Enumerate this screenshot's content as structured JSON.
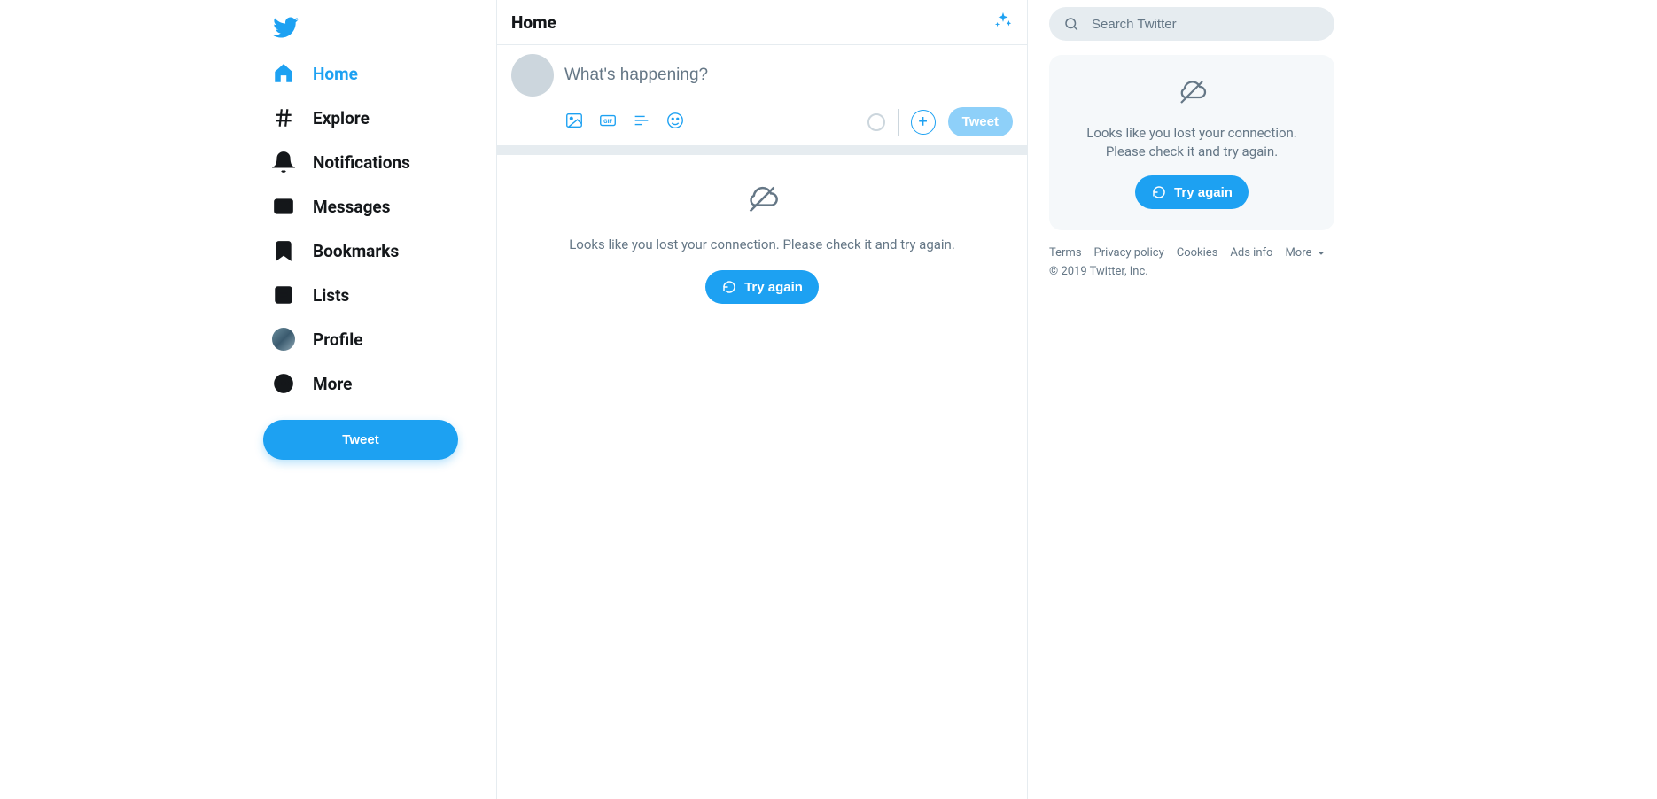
{
  "nav": {
    "items": [
      {
        "label": "Home"
      },
      {
        "label": "Explore"
      },
      {
        "label": "Notifications"
      },
      {
        "label": "Messages"
      },
      {
        "label": "Bookmarks"
      },
      {
        "label": "Lists"
      },
      {
        "label": "Profile"
      },
      {
        "label": "More"
      }
    ],
    "tweet_label": "Tweet"
  },
  "header": {
    "title": "Home"
  },
  "compose": {
    "placeholder": "What's happening?",
    "tweet_label": "Tweet"
  },
  "error": {
    "message": "Looks like you lost your connection. Please check it and try again.",
    "retry_label": "Try again"
  },
  "search": {
    "placeholder": "Search Twitter"
  },
  "rail_error": {
    "message": "Looks like you lost your connection. Please check it and try again.",
    "retry_label": "Try again"
  },
  "footer": {
    "links": [
      "Terms",
      "Privacy policy",
      "Cookies",
      "Ads info"
    ],
    "more_label": "More",
    "copyright": "© 2019 Twitter, Inc."
  }
}
